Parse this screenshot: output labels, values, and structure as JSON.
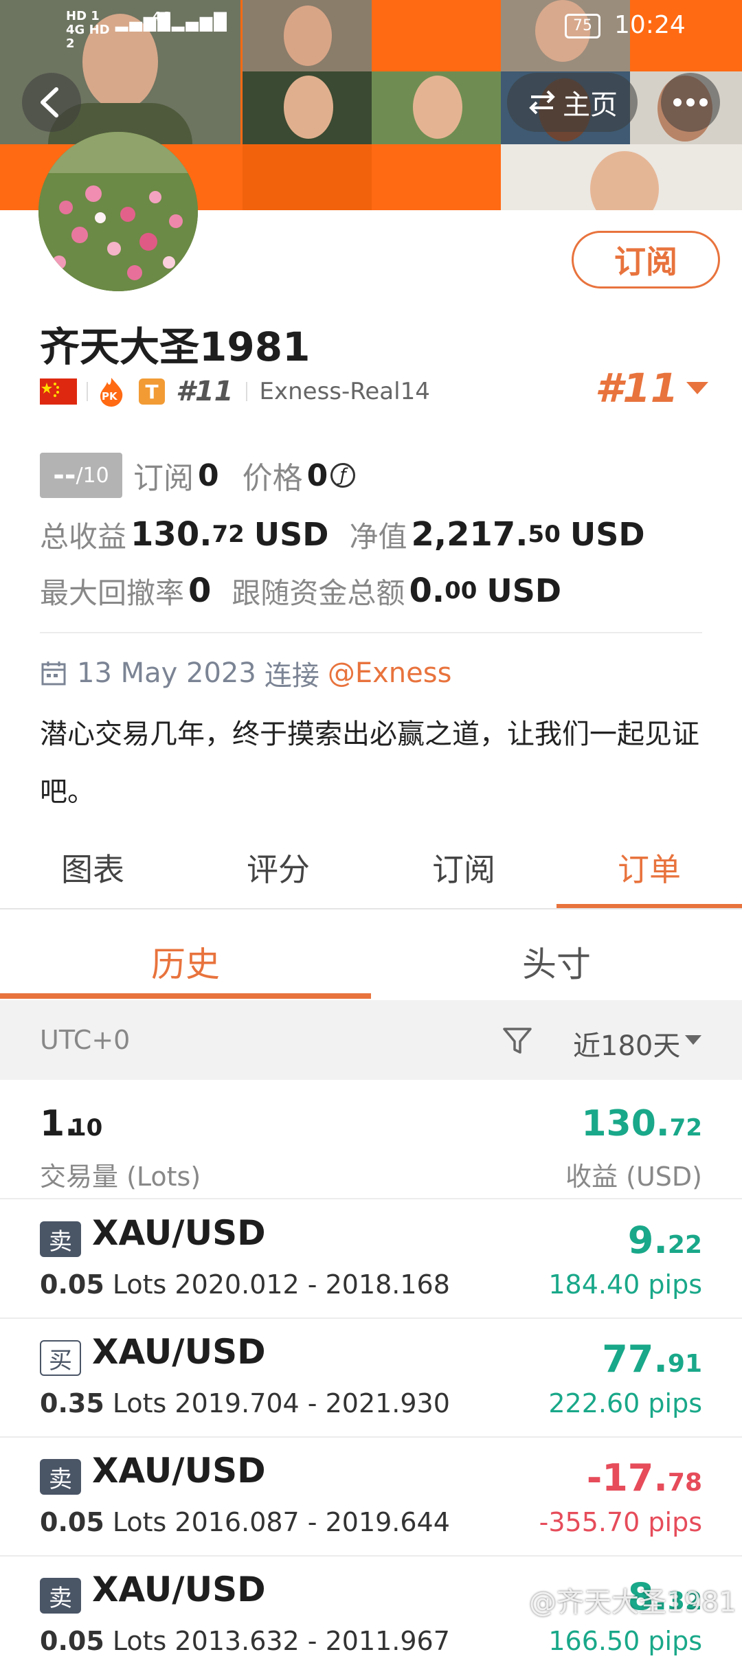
{
  "status_bar": {
    "signal_left": "HD 1 4G HD 2",
    "signal_right": "4G",
    "battery": "75",
    "time": "10:24"
  },
  "nav": {
    "home_label": "主页"
  },
  "profile": {
    "subscribe_label": "订阅",
    "name": "齐天大圣1981",
    "pk_badge": "PK",
    "tier_badge": "T",
    "rank_small": "#11",
    "server": "Exness-Real14",
    "rank_large": "#11",
    "score_main": "--",
    "score_den": "/10",
    "subs_label": "订阅",
    "subs_value": "0",
    "price_label": "价格",
    "price_value": "0",
    "price_icon": "ƒ",
    "total_profit_label": "总收益",
    "total_profit_int": "130.",
    "total_profit_dec": "72",
    "total_profit_unit": "USD",
    "equity_label": "净值",
    "equity_int": "2,217.",
    "equity_dec": "50",
    "equity_unit": "USD",
    "drawdown_label": "最大回撤率",
    "drawdown_value": "0",
    "follow_label": "跟随资金总额",
    "follow_int": "0.",
    "follow_dec": "00",
    "follow_unit": "USD",
    "date": "13 May 2023",
    "connect_label": "连接",
    "broker": "@Exness",
    "bio_line1": "潜心交易几年，终于摸索出必赢之道，让我们一起见证",
    "bio_line2": "吧。"
  },
  "tabs": [
    "图表",
    "评分",
    "订阅",
    "订单"
  ],
  "subtabs": [
    "历史",
    "头寸"
  ],
  "filter": {
    "timezone": "UTC+0",
    "range": "近180天"
  },
  "summary": {
    "lots_int": "1.",
    "lots_dec": "10",
    "lots_label": "交易量 (Lots)",
    "profit_int": "130.",
    "profit_dec": "72",
    "profit_label": "收益 (USD)"
  },
  "orders": [
    {
      "side": "卖",
      "symbol": "XAU/USD",
      "lots": "0.05",
      "lots_unit": "Lots",
      "prices": "2020.012 - 2018.168",
      "profit_int": "9.",
      "profit_dec": "22",
      "pips": "184.40 pips"
    },
    {
      "side": "买",
      "symbol": "XAU/USD",
      "lots": "0.35",
      "lots_unit": "Lots",
      "prices": "2019.704 - 2021.930",
      "profit_int": "77.",
      "profit_dec": "91",
      "pips": "222.60 pips"
    },
    {
      "side": "卖",
      "symbol": "XAU/USD",
      "lots": "0.05",
      "lots_unit": "Lots",
      "prices": "2016.087 - 2019.644",
      "profit_int": "-17.",
      "profit_dec": "78",
      "pips": "-355.70 pips"
    },
    {
      "side": "卖",
      "symbol": "XAU/USD",
      "lots": "0.05",
      "lots_unit": "Lots",
      "prices": "2013.632 - 2011.967",
      "profit_int": "8.",
      "profit_dec": "32",
      "pips": "166.50 pips"
    }
  ],
  "watermark": "@齐天大圣1981",
  "colors": {
    "accent": "#e8733d",
    "profit": "#19a889",
    "loss": "#e64c5a",
    "header_orange": "#ff6a13"
  }
}
